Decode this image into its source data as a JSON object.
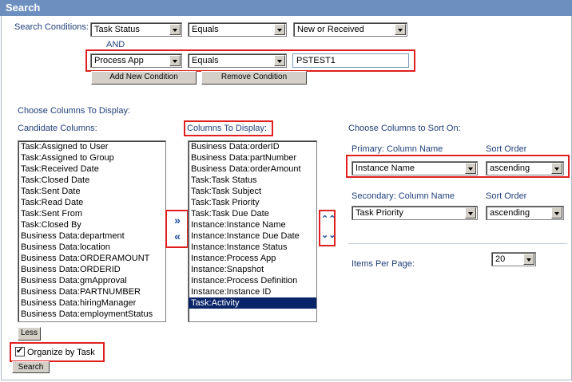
{
  "window": {
    "title": "Search"
  },
  "conditions": {
    "label": "Search Conditions:",
    "and_label": "AND",
    "row1": {
      "field": "Task Status",
      "operator": "Equals",
      "value": "New or Received"
    },
    "row2": {
      "field": "Process App",
      "operator": "Equals",
      "value": "PSTEST1"
    },
    "add_button": "Add New Condition",
    "remove_button": "Remove Condition"
  },
  "columns": {
    "heading": "Choose Columns To Display:",
    "candidate_label": "Candidate Columns:",
    "display_label": "Columns To Display:",
    "candidate": [
      "Task:Assigned to User",
      "Task:Assigned to Group",
      "Task:Received Date",
      "Task:Closed Date",
      "Task:Sent Date",
      "Task:Read Date",
      "Task:Sent From",
      "Task:Closed By",
      "Business Data:department",
      "Business Data:location",
      "Business Data:ORDERAMOUNT",
      "Business Data:ORDERID",
      "Business Data:gmApproval",
      "Business Data:PARTNUMBER",
      "Business Data:hiringManager",
      "Business Data:employmentStatus"
    ],
    "display": [
      "Business Data:orderID",
      "Business Data:partNumber",
      "Business Data:orderAmount",
      "Task:Task Status",
      "Task:Task Subject",
      "Task:Task Priority",
      "Task:Task Due Date",
      "Instance:Instance Name",
      "Instance:Instance Due Date",
      "Instance:Instance Status",
      "Instance:Process App",
      "Instance:Snapshot",
      "Instance:Process Definition",
      "Instance:Instance ID",
      "Task:Activity"
    ],
    "selected_display": "Task:Activity",
    "add_icon": "double-right-arrow",
    "remove_icon": "double-left-arrow",
    "up_icon": "double-up-arrow",
    "down_icon": "double-down-arrow"
  },
  "sort": {
    "heading": "Choose Columns to Sort On:",
    "primary_label": "Primary: Column Name",
    "secondary_label": "Secondary: Column Name",
    "order_label": "Sort Order",
    "primary_column": "Instance Name",
    "primary_order": "ascending",
    "secondary_column": "Task Priority",
    "secondary_order": "ascending"
  },
  "paging": {
    "label": "Items Per Page:",
    "value": "20"
  },
  "less_button": "Less",
  "organize": {
    "label": "Organize by Task",
    "checked": true
  },
  "search_button": "Search",
  "colors": {
    "title_bar": "#6d8fc0",
    "highlight": "#e02020",
    "selected_row": "#0a246a",
    "label_text": "#1f3f7a"
  }
}
